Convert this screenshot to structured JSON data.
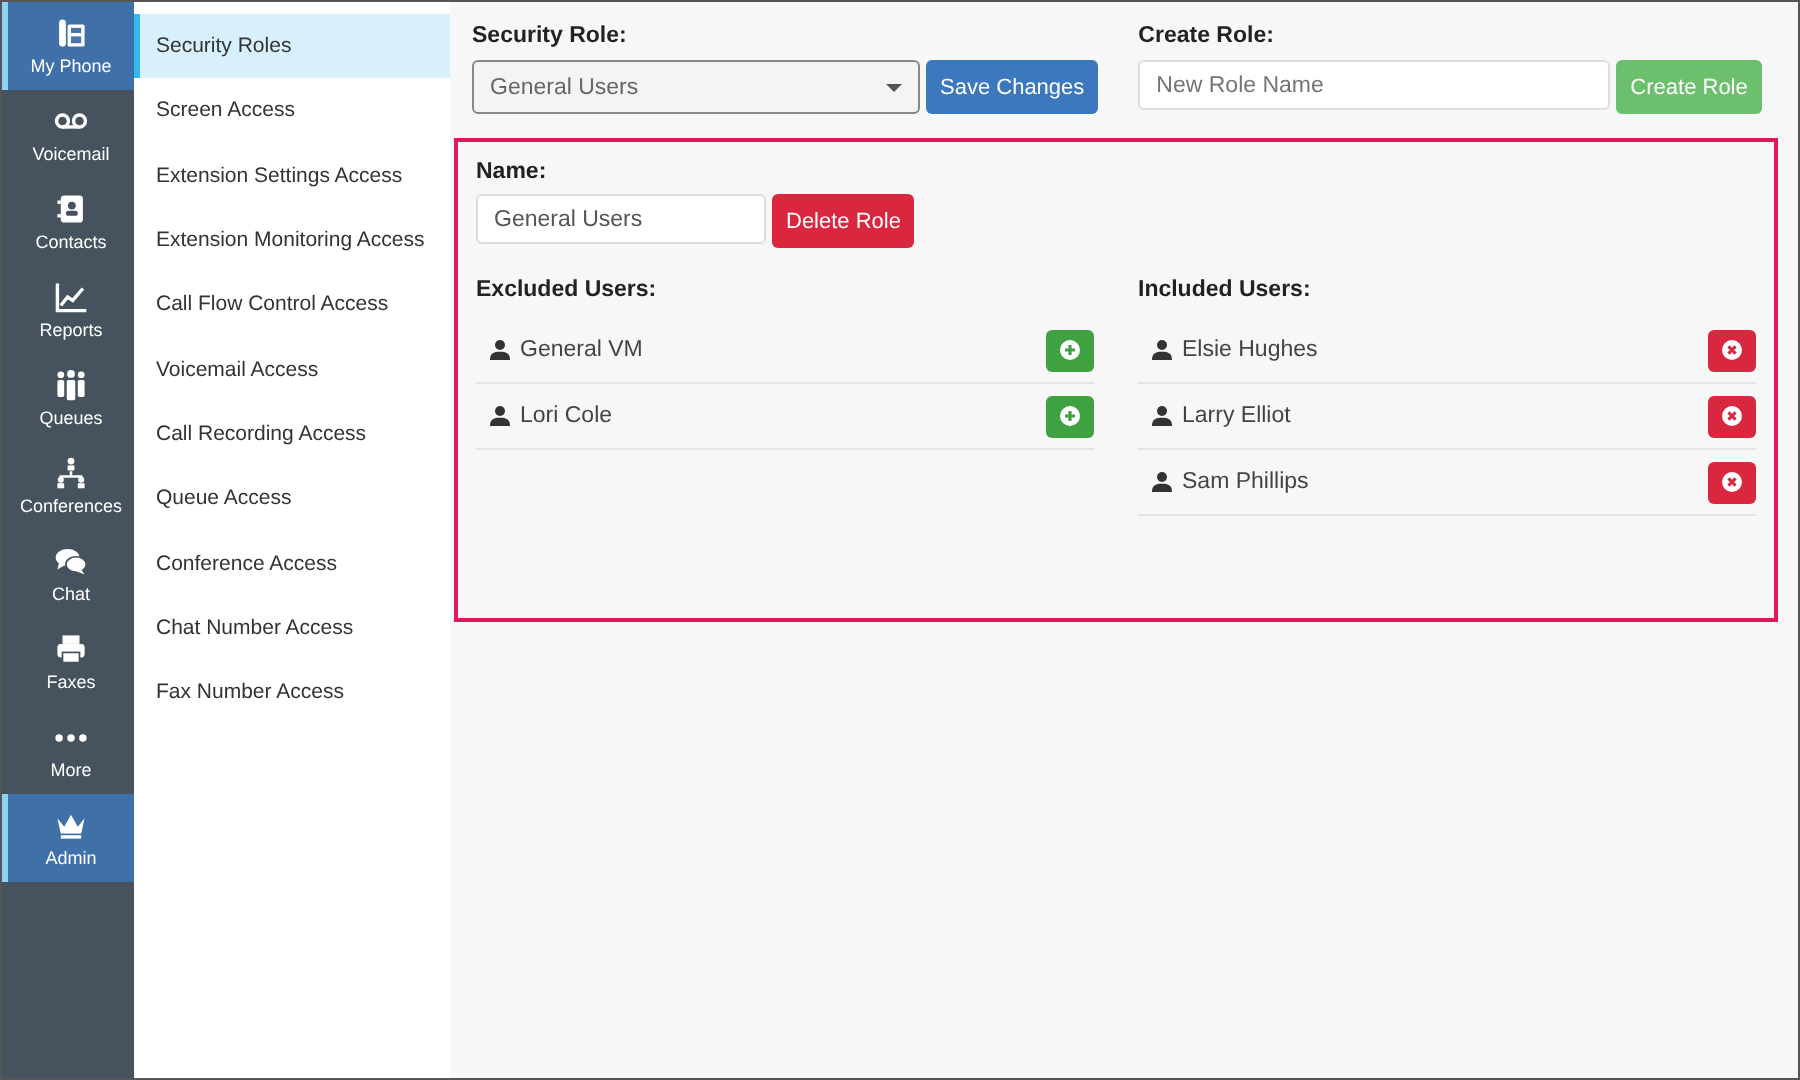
{
  "rail": [
    {
      "label": "My Phone",
      "selected": true
    },
    {
      "label": "Voicemail",
      "selected": false
    },
    {
      "label": "Contacts",
      "selected": false
    },
    {
      "label": "Reports",
      "selected": false
    },
    {
      "label": "Queues",
      "selected": false
    },
    {
      "label": "Conferences",
      "selected": false
    },
    {
      "label": "Chat",
      "selected": false
    },
    {
      "label": "Faxes",
      "selected": false
    },
    {
      "label": "More",
      "selected": false
    },
    {
      "label": "Admin",
      "selected": true
    }
  ],
  "submenu": [
    {
      "label": "Security Roles",
      "selected": true
    },
    {
      "label": "Screen Access",
      "selected": false
    },
    {
      "label": "Extension Settings Access",
      "selected": false
    },
    {
      "label": "Extension Monitoring Access",
      "selected": false
    },
    {
      "label": "Call Flow Control Access",
      "selected": false
    },
    {
      "label": "Voicemail Access",
      "selected": false
    },
    {
      "label": "Call Recording Access",
      "selected": false
    },
    {
      "label": "Queue Access",
      "selected": false
    },
    {
      "label": "Conference Access",
      "selected": false
    },
    {
      "label": "Chat Number Access",
      "selected": false
    },
    {
      "label": "Fax Number Access",
      "selected": false
    }
  ],
  "security_role": {
    "label": "Security Role:",
    "value": "General Users",
    "button": "Save Changes"
  },
  "create_role": {
    "label": "Create Role:",
    "placeholder": "New Role Name",
    "button": "Create Role"
  },
  "role_editor": {
    "name_label": "Name:",
    "name_value": "General Users",
    "delete_button": "Delete Role",
    "excluded": {
      "label": "Excluded Users:",
      "users": [
        {
          "name": "General VM"
        },
        {
          "name": "Lori Cole"
        }
      ]
    },
    "included": {
      "label": "Included Users:",
      "users": [
        {
          "name": "Elsie Hughes"
        },
        {
          "name": "Larry Elliot"
        },
        {
          "name": "Sam Phillips"
        }
      ]
    }
  }
}
